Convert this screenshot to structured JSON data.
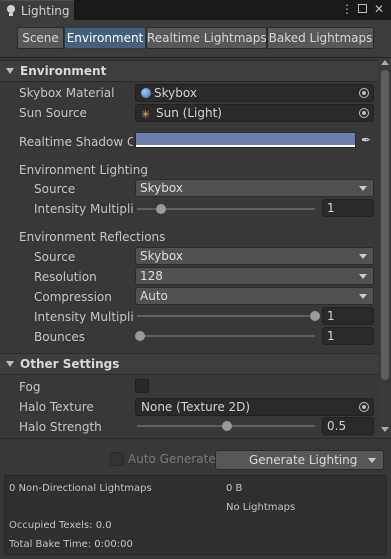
{
  "window": {
    "title": "Lighting"
  },
  "tabs": [
    {
      "label": "Scene"
    },
    {
      "label": "Environment"
    },
    {
      "label": "Realtime Lightmaps"
    },
    {
      "label": "Baked Lightmaps"
    }
  ],
  "environment": {
    "section_title": "Environment",
    "skybox_material": {
      "label": "Skybox Material",
      "value": "Skybox"
    },
    "sun_source": {
      "label": "Sun Source",
      "value": "Sun (Light)"
    },
    "realtime_shadow_color": {
      "label": "Realtime Shadow Color",
      "color": "#6b7fae"
    },
    "env_lighting": {
      "header": "Environment Lighting",
      "source": {
        "label": "Source",
        "value": "Skybox"
      },
      "intensity": {
        "label": "Intensity Multiplier",
        "value": "1",
        "level": 0.17
      }
    },
    "env_reflections": {
      "header": "Environment Reflections",
      "source": {
        "label": "Source",
        "value": "Skybox"
      },
      "resolution": {
        "label": "Resolution",
        "value": "128"
      },
      "compression": {
        "label": "Compression",
        "value": "Auto"
      },
      "intensity": {
        "label": "Intensity Multiplier",
        "value": "1",
        "level": 1.0
      },
      "bounces": {
        "label": "Bounces",
        "value": "1",
        "level": 0.0
      }
    }
  },
  "other_settings": {
    "section_title": "Other Settings",
    "fog": {
      "label": "Fog",
      "checked": false
    },
    "halo_texture": {
      "label": "Halo Texture",
      "value": "None (Texture 2D)"
    },
    "halo_strength": {
      "label": "Halo Strength",
      "value": "0.5",
      "level": 0.5
    }
  },
  "footer": {
    "auto_generate_label": "Auto Generate",
    "generate_button": "Generate Lighting",
    "stats": {
      "lightmaps_count": "0 Non-Directional Lightmaps",
      "lightmaps_size": "0 B",
      "lightmaps_status": "No Lightmaps",
      "occupied_texels": "Occupied Texels: 0.0",
      "total_bake_time": "Total Bake Time: 0:00:00"
    }
  },
  "colors": {
    "accent": "#46607c",
    "background": "#383838",
    "shadow_color": "#6b7fae"
  }
}
